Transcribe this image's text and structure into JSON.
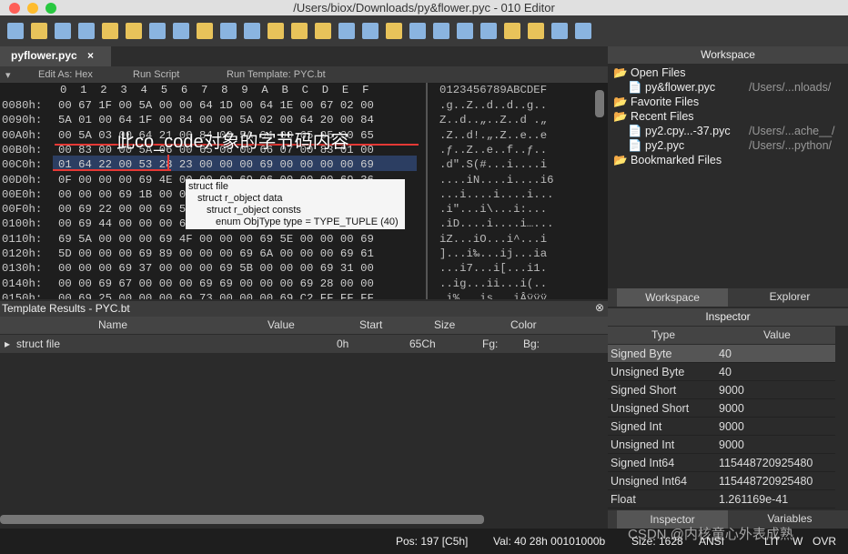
{
  "window": {
    "title": "/Users/biox/Downloads/py&flower.pyc - 010 Editor"
  },
  "tab": {
    "name": "pyflower.pyc",
    "close": "×"
  },
  "subbar": {
    "edit_as": "Edit As: Hex",
    "run_script": "Run Script",
    "run_template": "Run Template: PYC.bt"
  },
  "hex_header": {
    "cols": "0  1  2  3  4  5  6  7  8  9  A  B  C  D  E  F",
    "ascii": "0123456789ABCDEF"
  },
  "rows": [
    {
      "addr": "0080h:",
      "hex": "00 67 1F 00 5A 00 00 64 1D 00 64 1E 00 67 02 00",
      "ascii": ".g..Z..d..d..g.."
    },
    {
      "addr": "0090h:",
      "hex": "5A 01 00 64 1F 00 84 00 00 5A 02 00 64 20 00 84",
      "ascii": "Z..d..„..Z..d .„"
    },
    {
      "addr": "00A0h:",
      "hex": "00 5A 03 00 64 21 00 84 00 5A 04 00 65 05 00 65",
      "ascii": ".Z..d!.„.Z..e..e"
    },
    {
      "addr": "00B0h:",
      "hex": "00 83 00 00 5A 06 00 65 06 00 66 07 00 83 01 00",
      "ascii": ".ƒ..Z..e..f..ƒ.."
    },
    {
      "addr": "00C0h:",
      "hex": "01 64 22 00 53 28 23 00 00 00 69 00 00 00 00 69",
      "ascii": ".d\".S(#...i....i"
    },
    {
      "addr": "00D0h:",
      "hex": "0F 00 00 00 69 4E 00 00 00 69 06 00 00 00 69 36",
      "ascii": "....iN....i....i6"
    },
    {
      "addr": "00E0h:",
      "hex": "00 00 00 69 1B 00 00 00 69 00 00 00 69 00 00 00",
      "ascii": "...i....i....i..."
    },
    {
      "addr": "00F0h:",
      "hex": "00 69 22 00 00 69 5C 00 00 00 69 00 00 00 00 00",
      "ascii": ".i\"...i\\...i:..."
    },
    {
      "addr": "0100h:",
      "hex": "00 69 44 00 00 00 69 00 00 00 69 00 00 00 00 00",
      "ascii": ".iD....i....i…..."
    },
    {
      "addr": "0110h:",
      "hex": "69 5A 00 00 00 69 4F 00 00 00 69 5E 00 00 00 69",
      "ascii": "iZ...iO...i^...i"
    },
    {
      "addr": "0120h:",
      "hex": "5D 00 00 00 69 89 00 00 00 69 6A 00 00 00 69 61",
      "ascii": "]...i‰...ij...ia"
    },
    {
      "addr": "0130h:",
      "hex": "00 00 00 69 37 00 00 00 69 5B 00 00 00 69 31 00",
      "ascii": "...i7...i[...i1."
    },
    {
      "addr": "0140h:",
      "hex": "00 00 69 67 00 00 00 69 69 00 00 00 69 28 00 00",
      "ascii": "..ig...ii...i(.."
    },
    {
      "addr": "0150h:",
      "hex": "00 69 25 00 00 00 69 73 00 00 00 69 C2 FF FF FF",
      "ascii": ".i%...is...iÂÿÿÿ"
    }
  ],
  "annotation": "此co_code对象的字节码内容",
  "tooltip": [
    "struct file",
    "struct r_object data",
    "struct r_object consts",
    "enum ObjType type = TYPE_TUPLE (40)"
  ],
  "template": {
    "title": "Template Results - PYC.bt",
    "cols": [
      "Name",
      "Value",
      "Start",
      "Size",
      "Color"
    ],
    "row": {
      "name": "struct file",
      "value": "",
      "start": "0h",
      "size": "65Ch",
      "fg": "Fg:",
      "bg": "Bg:"
    }
  },
  "workspace": {
    "title": "Workspace",
    "open": "Open Files",
    "open_file": "py&flower.pyc",
    "open_path": "/Users/...nloads/",
    "fav": "Favorite Files",
    "recent": "Recent Files",
    "r1": "py2.cpy...-37.pyc",
    "r1p": "/Users/...ache__/",
    "r2": "py2.pyc",
    "r2p": "/Users/...python/",
    "bm": "Bookmarked Files",
    "tab1": "Workspace",
    "tab2": "Explorer"
  },
  "inspector": {
    "title": "Inspector",
    "col1": "Type",
    "col2": "Value",
    "rows": [
      [
        "Signed Byte",
        "40"
      ],
      [
        "Unsigned Byte",
        "40"
      ],
      [
        "Signed Short",
        "9000"
      ],
      [
        "Unsigned Short",
        "9000"
      ],
      [
        "Signed Int",
        "9000"
      ],
      [
        "Unsigned Int",
        "9000"
      ],
      [
        "Signed Int64",
        "115448720925480"
      ],
      [
        "Unsigned Int64",
        "115448720925480"
      ],
      [
        "Float",
        "1.261169e-41"
      ]
    ],
    "tab1": "Inspector",
    "tab2": "Variables"
  },
  "status": {
    "pos": "Pos: 197 [C5h]",
    "val": "Val: 40 28h 00101000b",
    "size": "Size: 1628",
    "enc": "ANSI",
    "lit": "LIT",
    "w": "W",
    "ovr": "OVR"
  },
  "watermark": "CSDN @内核童心外表成熟"
}
